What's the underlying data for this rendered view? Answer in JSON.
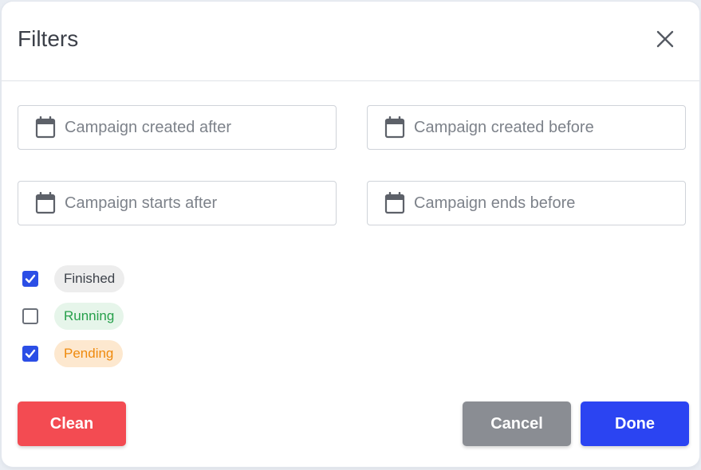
{
  "dialog": {
    "title": "Filters",
    "close_icon": "close-icon"
  },
  "date_filters": [
    {
      "placeholder": "Campaign created after",
      "icon": "calendar-icon"
    },
    {
      "placeholder": "Campaign created before",
      "icon": "calendar-icon"
    },
    {
      "placeholder": "Campaign starts after",
      "icon": "calendar-icon"
    },
    {
      "placeholder": "Campaign ends before",
      "icon": "calendar-icon"
    }
  ],
  "statuses": [
    {
      "label": "Finished",
      "checked": true,
      "color": "#3d424a",
      "background": "#ededed"
    },
    {
      "label": "Running",
      "checked": false,
      "color": "#26a04b",
      "background": "#e6f5ea"
    },
    {
      "label": "Pending",
      "checked": true,
      "color": "#ef8a0d",
      "background": "#fde8cf"
    }
  ],
  "buttons": {
    "clean": "Clean",
    "cancel": "Cancel",
    "done": "Done"
  },
  "colors": {
    "accent": "#2b44f2",
    "danger": "#f34b52",
    "neutral": "#8a8d93"
  }
}
